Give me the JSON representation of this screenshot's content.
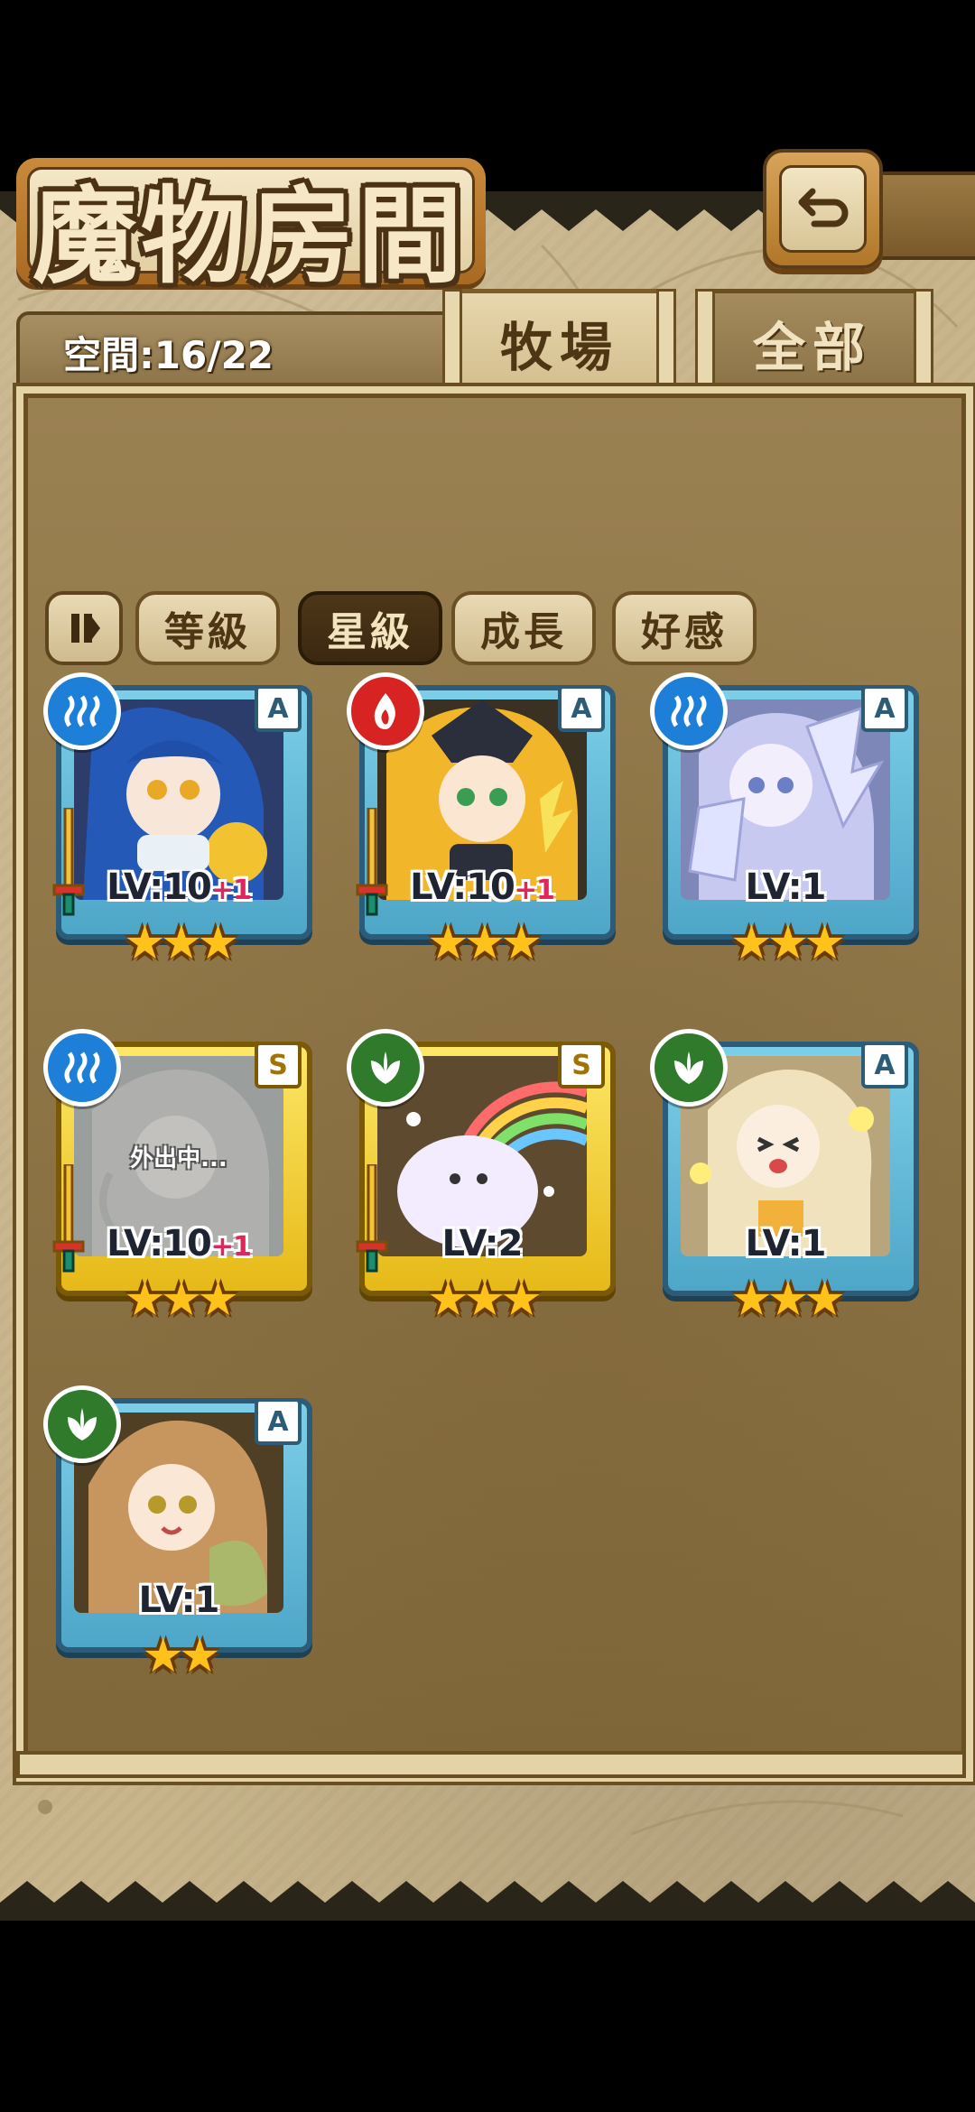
{
  "header": {
    "title": "魔物房間",
    "capacity": "空間:16/22"
  },
  "tabs": [
    {
      "label": "牧場",
      "active": true
    },
    {
      "label": "全部",
      "active": false
    }
  ],
  "sort": {
    "options": [
      "等級",
      "星級",
      "成長",
      "好感"
    ],
    "active": "星級"
  },
  "monsters": [
    {
      "element": "water",
      "rank": "A",
      "level": "LV:10",
      "bonus": "+1",
      "stars": "★★★",
      "frame": "blue",
      "status": ""
    },
    {
      "element": "fire",
      "rank": "A",
      "level": "LV:10",
      "bonus": "+1",
      "stars": "★★★",
      "frame": "blue",
      "status": ""
    },
    {
      "element": "water",
      "rank": "A",
      "level": "LV:1",
      "bonus": "",
      "stars": "★★★",
      "frame": "blue",
      "status": ""
    },
    {
      "element": "water",
      "rank": "S",
      "level": "LV:10",
      "bonus": "+1",
      "stars": "★★★",
      "frame": "gold",
      "status": "外出中..."
    },
    {
      "element": "wood",
      "rank": "S",
      "level": "LV:2",
      "bonus": "",
      "stars": "★★★",
      "frame": "gold",
      "status": ""
    },
    {
      "element": "wood",
      "rank": "A",
      "level": "LV:1",
      "bonus": "",
      "stars": "★★★",
      "frame": "blue",
      "status": ""
    },
    {
      "element": "wood",
      "rank": "A",
      "level": "LV:1",
      "bonus": "",
      "stars": "★★",
      "frame": "blue",
      "status": ""
    }
  ],
  "colors": {
    "water": "#1d7fd8",
    "fire": "#d82323",
    "wood": "#2f7b2b",
    "star": "#ffc21a",
    "bonus": "#e0265a"
  }
}
